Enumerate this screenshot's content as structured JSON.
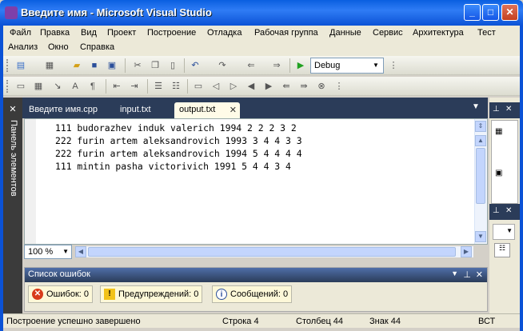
{
  "window": {
    "title": "Введите имя - Microsoft Visual Studio"
  },
  "menu": [
    "Файл",
    "Правка",
    "Вид",
    "Проект",
    "Построение",
    "Отладка",
    "Рабочая группа",
    "Данные",
    "Сервис",
    "Архитектура",
    "Тест",
    "Анализ",
    "Окно",
    "Справка"
  ],
  "toolbar": {
    "configuration": "Debug"
  },
  "sidebar": {
    "toolbox_label": "Панель элементов"
  },
  "tabs": [
    {
      "label": "Введите имя.cpp"
    },
    {
      "label": "input.txt"
    },
    {
      "label": "output.txt"
    }
  ],
  "editor": {
    "lines": [
      "111 budorazhev induk valerich 1994 2 2 2 3 2",
      "222 furin artem aleksandrovich 1993 3 4 4 3 3",
      "222 furin artem aleksandrovich 1994 5 4 4 4 4",
      "111 mintin pasha victorivich 1991 5 4 4 3 4"
    ],
    "zoom": "100 %"
  },
  "error_list": {
    "title": "Список ошибок",
    "errors": "Ошибок: 0",
    "warnings": "Предупреждений: 0",
    "messages": "Сообщений: 0"
  },
  "statusbar": {
    "message": "Построение успешно завершено",
    "line": "Строка 4",
    "column": "Столбец 44",
    "char": "Знак 44",
    "mode": "ВСТ"
  }
}
